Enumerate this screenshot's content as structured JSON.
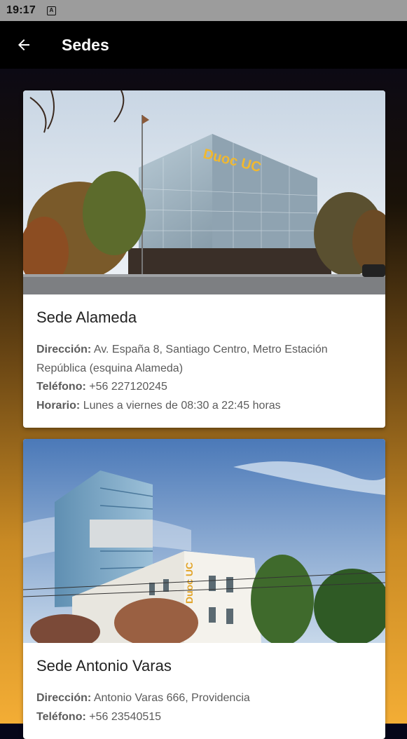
{
  "status_bar": {
    "time": "19:17",
    "notification_icon": "a-icon"
  },
  "app_bar": {
    "back_icon": "arrow-left-icon",
    "title": "Sedes"
  },
  "campuses": [
    {
      "name": "Sede Alameda",
      "address_label": "Dirección:",
      "address": "Av. España 8, Santiago Centro, Metro Estación República (esquina Alameda)",
      "phone_label": "Teléfono:",
      "phone": "+56 227120245",
      "hours_label": "Horario:",
      "hours": "Lunes a viernes de 08:30 a 22:45 horas",
      "building_sign": "Duoc UC"
    },
    {
      "name": "Sede Antonio Varas",
      "address_label": "Dirección:",
      "address": "Antonio Varas 666, Providencia",
      "phone_label": "Teléfono:",
      "phone": "+56 23540515",
      "building_sign": "Duoc UC"
    }
  ]
}
